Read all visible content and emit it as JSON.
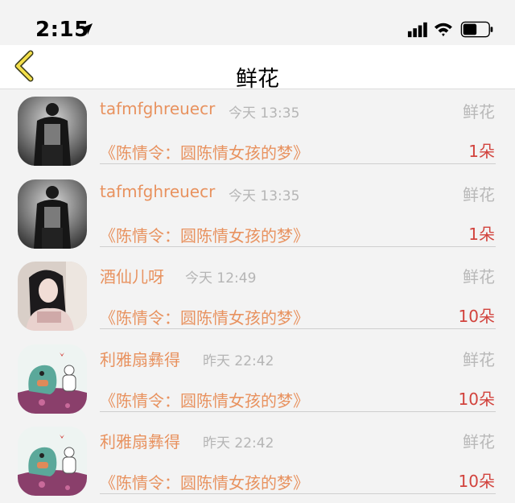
{
  "status_bar": {
    "time": "2:15"
  },
  "nav": {
    "title": "鲜花"
  },
  "rows": [
    {
      "name": "tafmfghreuecr",
      "time": "今天 13:35",
      "type": "鲜花",
      "book": "《陈情令：圆陈情女孩的梦》",
      "count": "1朵",
      "avatar": "dark-figure"
    },
    {
      "name": "tafmfghreuecr",
      "time": "今天 13:35",
      "type": "鲜花",
      "book": "《陈情令：圆陈情女孩的梦》",
      "count": "1朵",
      "avatar": "dark-figure"
    },
    {
      "name": "酒仙儿呀",
      "time": "今天 12:49",
      "type": "鲜花",
      "book": "《陈情令：圆陈情女孩的梦》",
      "count": "10朵",
      "avatar": "girl-photo"
    },
    {
      "name": "利雅扇彝得",
      "time": "昨天 22:42",
      "type": "鲜花",
      "book": "《陈情令：圆陈情女孩的梦》",
      "count": "10朵",
      "avatar": "cartoon-dino"
    },
    {
      "name": "利雅扇彝得",
      "time": "昨天 22:42",
      "type": "鲜花",
      "book": "《陈情令：圆陈情女孩的梦》",
      "count": "10朵",
      "avatar": "cartoon-dino"
    }
  ]
}
